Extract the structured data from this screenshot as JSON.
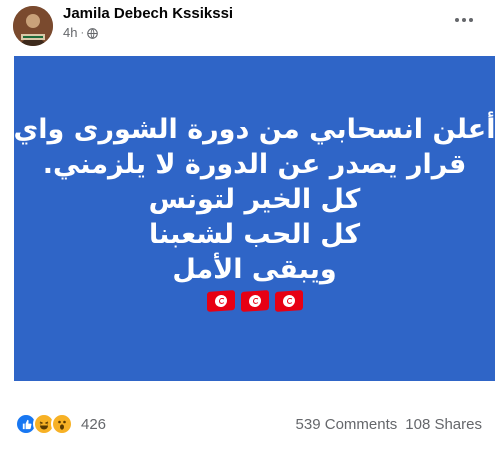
{
  "post": {
    "author": "Jamila Debech Kssikssi",
    "time": "4h",
    "separator": "·",
    "privacy_icon": "globe-icon",
    "more_icon": "more-options-icon"
  },
  "card": {
    "background": "#2f65c7",
    "lines": [
      "أعلن انسحابي من دورة الشورى واي",
      "قرار يصدر عن الدورة لا يلزمني.",
      "كل الخير لتونس",
      "كل الحب لشعبنا",
      "ويبقى الأمل"
    ],
    "flag_icons": [
      "tunisia-flag-icon",
      "tunisia-flag-icon",
      "tunisia-flag-icon"
    ]
  },
  "footer": {
    "reactions": [
      "like-icon",
      "haha-icon",
      "wow-icon"
    ],
    "reaction_count": "426",
    "comments": "539 Comments",
    "shares": "108 Shares"
  }
}
